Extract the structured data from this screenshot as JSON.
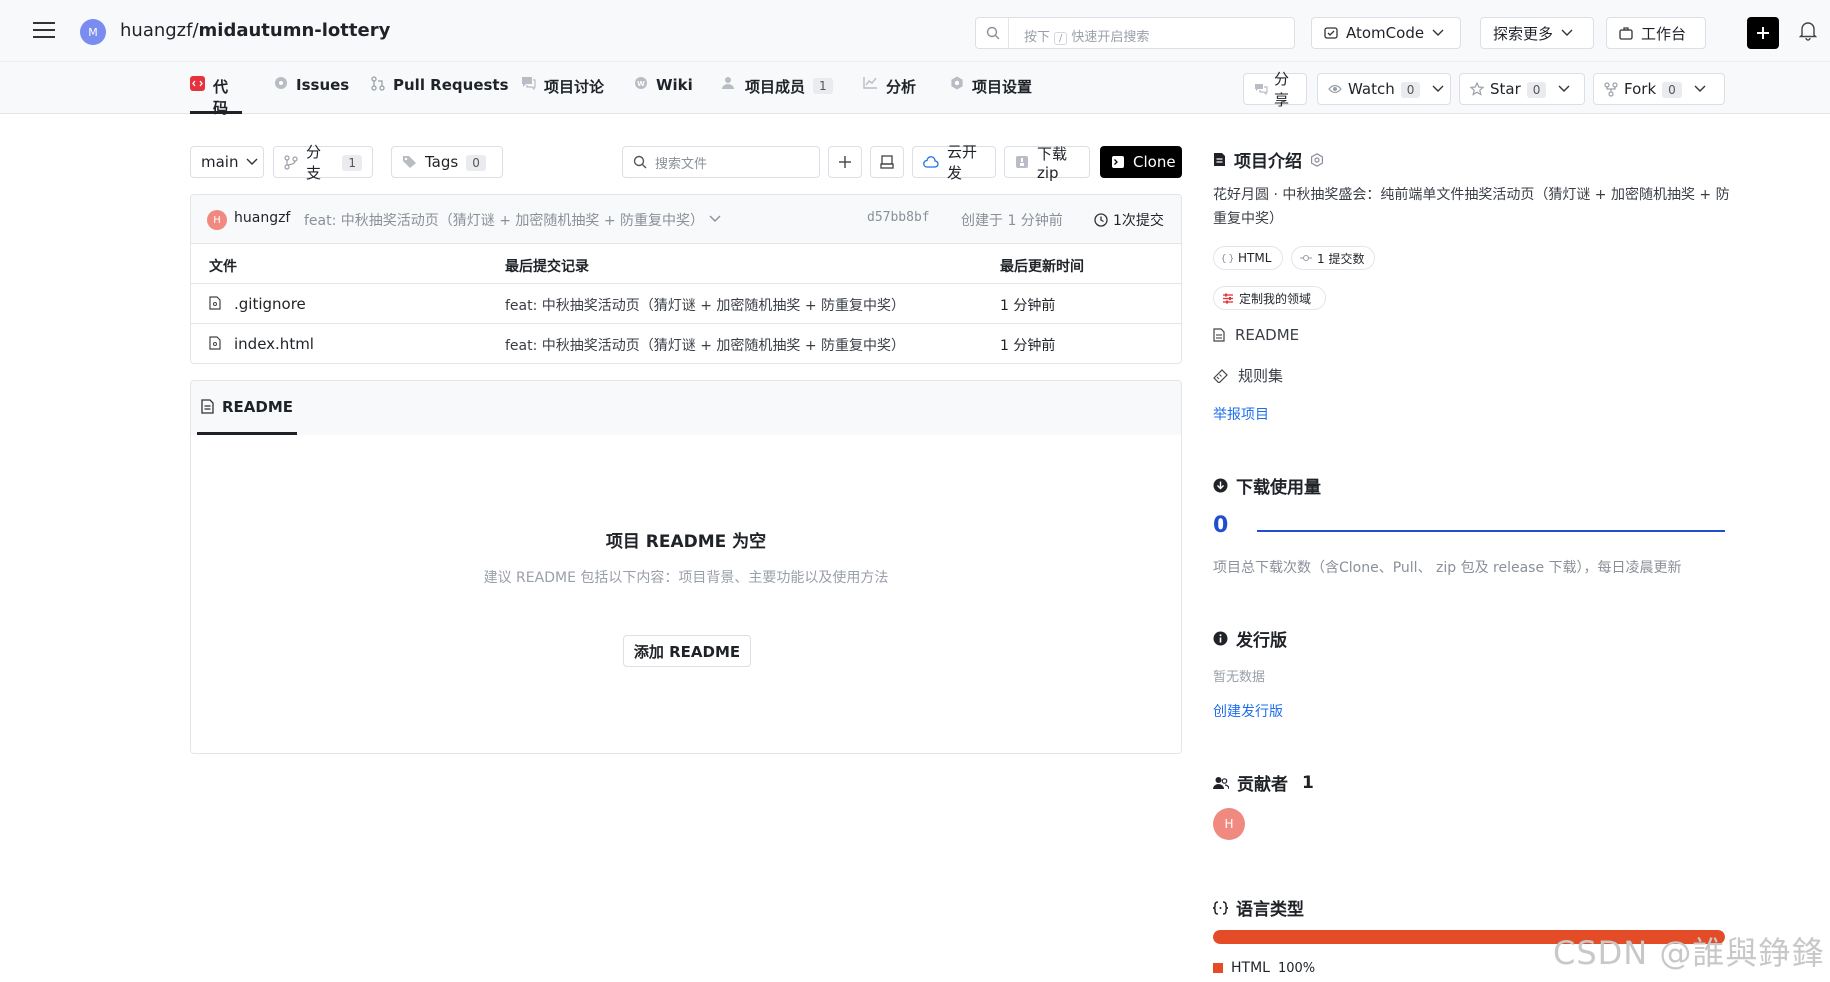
{
  "header": {
    "repo_avatar": "M",
    "repo_owner": "huangzf/",
    "repo_name": "midautumn-lottery",
    "search_prefix": "按下",
    "search_key": "/",
    "search_suffix": "快速开启搜索",
    "atomcode_label": "AtomCode",
    "explore_label": "探索更多",
    "workbench_label": "工作台"
  },
  "tabs": [
    {
      "label": "代码"
    },
    {
      "label": "Issues"
    },
    {
      "label": "Pull Requests"
    },
    {
      "label": "项目讨论"
    },
    {
      "label": "Wiki"
    },
    {
      "label": "项目成员",
      "count": "1"
    },
    {
      "label": "分析"
    },
    {
      "label": "项目设置"
    }
  ],
  "actions": {
    "share": "分享",
    "watch": "Watch",
    "watch_count": "0",
    "star": "Star",
    "star_count": "0",
    "fork": "Fork",
    "fork_count": "0"
  },
  "toolbar": {
    "branch": "main",
    "branches_label": "分支",
    "branches_count": "1",
    "tags_label": "Tags",
    "tags_count": "0",
    "search_placeholder": "搜索文件",
    "cloud_dev": "云开发",
    "download_zip": "下载zip",
    "clone": "Clone"
  },
  "commit": {
    "avatar": "H",
    "author": "huangzf",
    "message": "feat: 中秋抽奖活动页（猜灯谜 + 加密随机抽奖 + 防重复中奖）",
    "hash": "d57bb8bf",
    "created": "创建于 1 分钟前",
    "commits": "1次提交"
  },
  "table": {
    "headers": [
      "文件",
      "最后提交记录",
      "最后更新时间"
    ],
    "rows": [
      {
        "name": ".gitignore",
        "commit": "feat: 中秋抽奖活动页（猜灯谜 + 加密随机抽奖 + 防重复中奖）",
        "time": "1 分钟前"
      },
      {
        "name": "index.html",
        "commit": "feat: 中秋抽奖活动页（猜灯谜 + 加密随机抽奖 + 防重复中奖）",
        "time": "1 分钟前"
      }
    ]
  },
  "readme": {
    "tab": "README",
    "empty_title": "项目 README 为空",
    "empty_sub": "建议 README 包括以下内容：项目背景、主要功能以及使用方法",
    "add_button": "添加 README"
  },
  "sidebar": {
    "intro_title": "项目介绍",
    "intro_text": "花好月圆 · 中秋抽奖盛会：纯前端单文件抽奖活动页（猜灯谜 + 加密随机抽奖 + 防重复中奖）",
    "chip_lang": "HTML",
    "chip_commits": "1 提交数",
    "chip_custom": "定制我的领域",
    "readme_link": "README",
    "rules_link": "规则集",
    "report_link": "举报项目",
    "downloads_title": "下载使用量",
    "downloads_count": "0",
    "downloads_note": "项目总下载次数（含Clone、Pull、 zip 包及 release 下载），每日凌晨更新",
    "releases_title": "发行版",
    "releases_empty": "暂无数据",
    "releases_create": "创建发行版",
    "contributors_title": "贡献者",
    "contributors_count": "1",
    "contributor_avatar": "H",
    "languages_title": "语言类型",
    "language_name": "HTML",
    "language_percent": "100%",
    "language_share": 1.0
  },
  "watermark": "CSDN @誰與錚鋒",
  "colors": {
    "accent_link": "#1f6feb",
    "lang_html": "#e34c26",
    "active_tab_icon": "#e5323c"
  }
}
